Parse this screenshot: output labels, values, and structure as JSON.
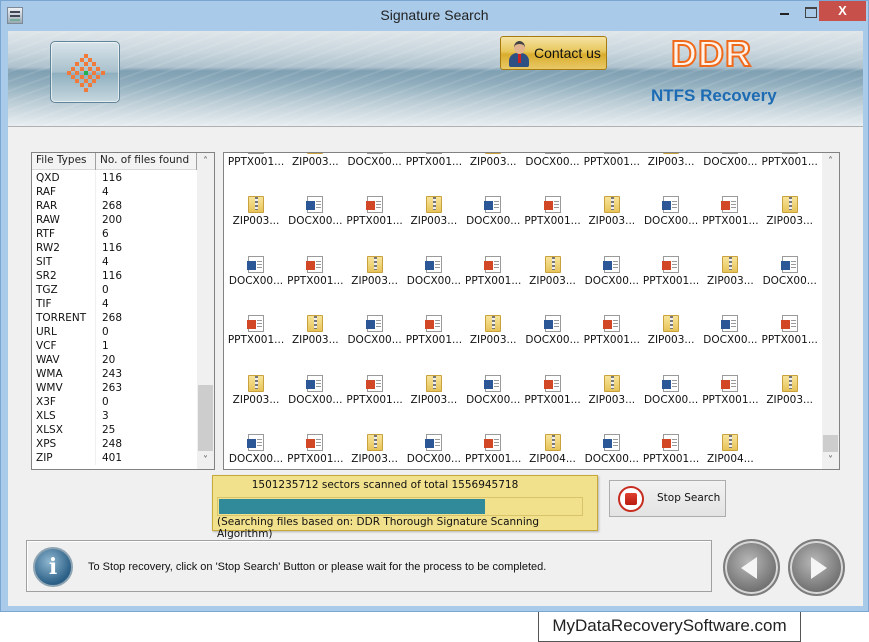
{
  "window": {
    "title": "Signature Search",
    "controls": {
      "minimize": "minimize",
      "maximize": "maximize",
      "close": "X"
    }
  },
  "banner": {
    "contact_label": "Contact us",
    "brand": "DDR",
    "product": "NTFS Recovery"
  },
  "file_types_table": {
    "columns": [
      "File Types",
      "No. of files found"
    ],
    "rows": [
      {
        "type": "QXD",
        "count": "116"
      },
      {
        "type": "RAF",
        "count": "4"
      },
      {
        "type": "RAR",
        "count": "268"
      },
      {
        "type": "RAW",
        "count": "200"
      },
      {
        "type": "RTF",
        "count": "6"
      },
      {
        "type": "RW2",
        "count": "116"
      },
      {
        "type": "SIT",
        "count": "4"
      },
      {
        "type": "SR2",
        "count": "116"
      },
      {
        "type": "TGZ",
        "count": "0"
      },
      {
        "type": "TIF",
        "count": "4"
      },
      {
        "type": "TORRENT",
        "count": "268"
      },
      {
        "type": "URL",
        "count": "0"
      },
      {
        "type": "VCF",
        "count": "1"
      },
      {
        "type": "WAV",
        "count": "20"
      },
      {
        "type": "WMA",
        "count": "243"
      },
      {
        "type": "WMV",
        "count": "263"
      },
      {
        "type": "X3F",
        "count": "0"
      },
      {
        "type": "XLS",
        "count": "3"
      },
      {
        "type": "XLSX",
        "count": "25"
      },
      {
        "type": "XPS",
        "count": "248"
      },
      {
        "type": "ZIP",
        "count": "401"
      }
    ]
  },
  "files_grid": {
    "rows": [
      [
        {
          "name": "PPTX001...",
          "icon": "pptx"
        },
        {
          "name": "ZIP003...",
          "icon": "zip"
        },
        {
          "name": "DOCX00...",
          "icon": "docx"
        },
        {
          "name": "PPTX001...",
          "icon": "pptx"
        },
        {
          "name": "ZIP003...",
          "icon": "zip"
        },
        {
          "name": "DOCX00...",
          "icon": "docx"
        },
        {
          "name": "PPTX001...",
          "icon": "pptx"
        },
        {
          "name": "ZIP003...",
          "icon": "zip"
        },
        {
          "name": "DOCX00...",
          "icon": "docx"
        },
        {
          "name": "PPTX001...",
          "icon": "pptx"
        }
      ],
      [
        {
          "name": "ZIP003...",
          "icon": "zip"
        },
        {
          "name": "DOCX00...",
          "icon": "docx"
        },
        {
          "name": "PPTX001...",
          "icon": "pptx"
        },
        {
          "name": "ZIP003...",
          "icon": "zip"
        },
        {
          "name": "DOCX00...",
          "icon": "docx"
        },
        {
          "name": "PPTX001...",
          "icon": "pptx"
        },
        {
          "name": "ZIP003...",
          "icon": "zip"
        },
        {
          "name": "DOCX00...",
          "icon": "docx"
        },
        {
          "name": "PPTX001...",
          "icon": "pptx"
        },
        {
          "name": "ZIP003...",
          "icon": "zip"
        }
      ],
      [
        {
          "name": "DOCX00...",
          "icon": "docx"
        },
        {
          "name": "PPTX001...",
          "icon": "pptx"
        },
        {
          "name": "ZIP003...",
          "icon": "zip"
        },
        {
          "name": "DOCX00...",
          "icon": "docx"
        },
        {
          "name": "PPTX001...",
          "icon": "pptx"
        },
        {
          "name": "ZIP003...",
          "icon": "zip"
        },
        {
          "name": "DOCX00...",
          "icon": "docx"
        },
        {
          "name": "PPTX001...",
          "icon": "pptx"
        },
        {
          "name": "ZIP003...",
          "icon": "zip"
        },
        {
          "name": "DOCX00...",
          "icon": "docx"
        }
      ],
      [
        {
          "name": "PPTX001...",
          "icon": "pptx"
        },
        {
          "name": "ZIP003...",
          "icon": "zip"
        },
        {
          "name": "DOCX00...",
          "icon": "docx"
        },
        {
          "name": "PPTX001...",
          "icon": "pptx"
        },
        {
          "name": "ZIP003...",
          "icon": "zip"
        },
        {
          "name": "DOCX00...",
          "icon": "docx"
        },
        {
          "name": "PPTX001...",
          "icon": "pptx"
        },
        {
          "name": "ZIP003...",
          "icon": "zip"
        },
        {
          "name": "DOCX00...",
          "icon": "docx"
        },
        {
          "name": "PPTX001...",
          "icon": "pptx"
        }
      ],
      [
        {
          "name": "ZIP003...",
          "icon": "zip"
        },
        {
          "name": "DOCX00...",
          "icon": "docx"
        },
        {
          "name": "PPTX001...",
          "icon": "pptx"
        },
        {
          "name": "ZIP003...",
          "icon": "zip"
        },
        {
          "name": "DOCX00...",
          "icon": "docx"
        },
        {
          "name": "PPTX001...",
          "icon": "pptx"
        },
        {
          "name": "ZIP003...",
          "icon": "zip"
        },
        {
          "name": "DOCX00...",
          "icon": "docx"
        },
        {
          "name": "PPTX001...",
          "icon": "pptx"
        },
        {
          "name": "ZIP003...",
          "icon": "zip"
        }
      ],
      [
        {
          "name": "DOCX00...",
          "icon": "docx"
        },
        {
          "name": "PPTX001...",
          "icon": "pptx"
        },
        {
          "name": "ZIP003...",
          "icon": "zip"
        },
        {
          "name": "DOCX00...",
          "icon": "docx"
        },
        {
          "name": "PPTX001...",
          "icon": "pptx"
        },
        {
          "name": "ZIP004...",
          "icon": "zip"
        },
        {
          "name": "DOCX00...",
          "icon": "docx"
        },
        {
          "name": "PPTX001...",
          "icon": "pptx"
        },
        {
          "name": "ZIP004...",
          "icon": "zip"
        }
      ]
    ]
  },
  "progress": {
    "sectors_text": "1501235712 sectors scanned of total 1556945718",
    "sectors_scanned": 1501235712,
    "sectors_total": 1556945718,
    "bar_fraction": 0.73,
    "algorithm_text": "(Searching files based on:  DDR Thorough Signature Scanning Algorithm)",
    "bar_color": "#318a99"
  },
  "stop_button": {
    "label": "Stop Search"
  },
  "info": {
    "text": "To Stop recovery, click on 'Stop Search' Button or please wait for the process to be completed."
  },
  "navigation": {
    "back": "back",
    "next": "next"
  },
  "watermark": "MyDataRecoverySoftware.com"
}
